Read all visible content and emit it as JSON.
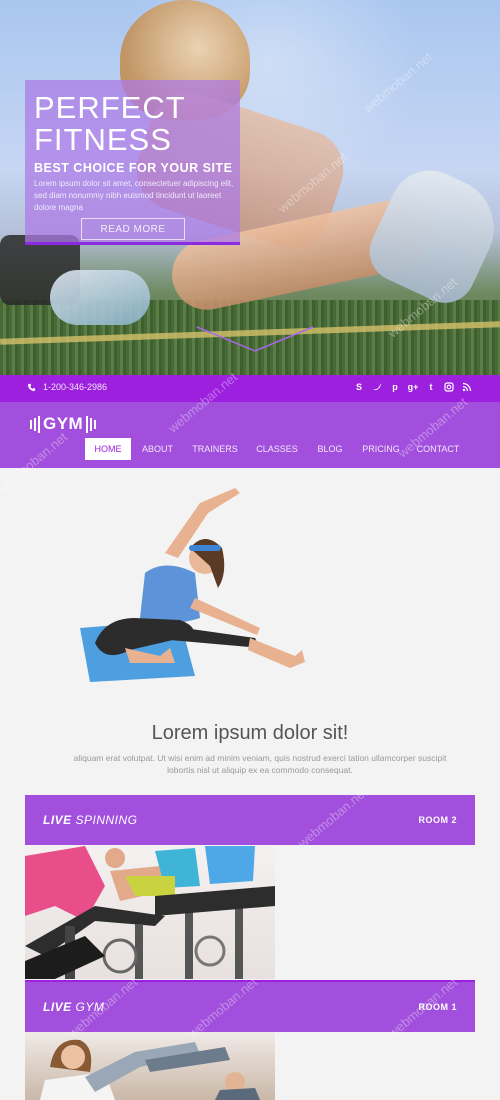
{
  "hero": {
    "title_line1": "PERFECT",
    "title_line2": "FITNESS",
    "subtitle": "BEST CHOICE FOR YOUR SITE",
    "text": "Lorem ipsum dolor sit amet, consectetuer adipiscing elit, sed diam nonummy nibh euismod tincidunt ut laoreet dolore magna",
    "read_more": "READ MORE"
  },
  "topbar": {
    "phone": "1-200-346-2986",
    "socials": [
      "skype-icon",
      "twitter-icon",
      "pinterest-icon",
      "google-plus-icon",
      "tumblr-icon",
      "instagram-icon",
      "rss-icon"
    ],
    "bg_color": "#9d20de"
  },
  "nav": {
    "logo": "GYM",
    "items": [
      {
        "label": "HOME",
        "active": true
      },
      {
        "label": "ABOUT"
      },
      {
        "label": "TRAINERS"
      },
      {
        "label": "CLASSES"
      },
      {
        "label": "BLOG"
      },
      {
        "label": "PRICING"
      },
      {
        "label": "CONTACT"
      }
    ],
    "bg_color": "#a14fdc"
  },
  "intro": {
    "heading": "Lorem ipsum dolor sit!",
    "text": "aliquam erat volutpat. Ut wisi enim ad minim veniam, quis nostrud exerci tation ullamcorper suscipit lobortis nisl ut aliquip ex ea commodo consequat."
  },
  "classes": [
    {
      "name_bold": "LIVE",
      "name_rest": " SPINNING",
      "room": "ROOM 2"
    },
    {
      "name_bold": "LIVE",
      "name_rest": " GYM",
      "room": "ROOM 1"
    }
  ],
  "watermark": "webmoban.net"
}
